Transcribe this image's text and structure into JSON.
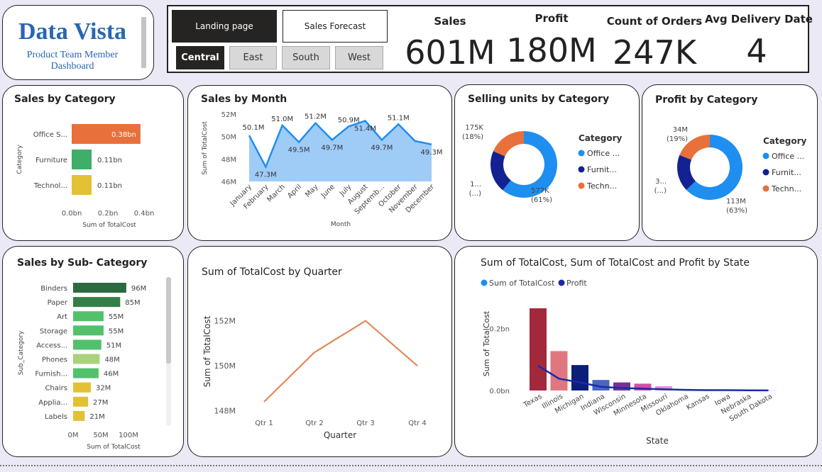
{
  "logo": {
    "brand": "Data Vista",
    "sub1": "Product Team Member",
    "sub2": "Dashboard"
  },
  "nav": {
    "landing": "Landing page",
    "forecast": "Sales Forecast"
  },
  "regions": [
    "Central",
    "East",
    "South",
    "West"
  ],
  "kpis": [
    {
      "label": "Sales",
      "value": "601M"
    },
    {
      "label": "Profit",
      "value": "180M"
    },
    {
      "label": "Count of Orders",
      "value": "247K"
    },
    {
      "label": "Avg Delivery Date",
      "value": "4"
    }
  ],
  "colors": {
    "orange": "#e8703a",
    "green": "#3fae6a",
    "yellow": "#e3c134",
    "blue": "#1e8ef0",
    "navy": "#142190",
    "area": "#9fcbf7",
    "line": "#1e8ef0",
    "quarter": "#e08a5c"
  },
  "chart_data": [
    {
      "id": "sales-by-category",
      "type": "bar",
      "orientation": "horizontal",
      "title": "Sales by Category",
      "xlabel": "Sum of TotalCost",
      "ylabel": "Category",
      "categories": [
        "Office S...",
        "Furniture",
        "Technol..."
      ],
      "values": [
        0.38,
        0.11,
        0.11
      ],
      "data_labels": [
        "0.38bn",
        "0.11bn",
        "0.11bn"
      ],
      "xticks": [
        "0.0bn",
        "0.2bn",
        "0.4bn"
      ],
      "xlim": [
        0,
        0.4
      ]
    },
    {
      "id": "sales-by-month",
      "type": "area",
      "title": "Sales by Month",
      "xlabel": "Month",
      "ylabel": "Sum of TotalCost",
      "x": [
        "January",
        "February",
        "March",
        "April",
        "May",
        "June",
        "July",
        "August",
        "Septemb...",
        "October",
        "November",
        "December"
      ],
      "values": [
        50.1,
        47.3,
        51.0,
        49.5,
        51.2,
        49.7,
        50.9,
        51.4,
        49.7,
        51.1,
        49.6,
        49.3
      ],
      "data_labels": [
        "50.1M",
        "47.3M",
        "51.0M",
        "49.5M",
        "51.2M",
        "49.7M",
        "50.9M",
        "51.4M",
        "49.7M",
        "51.1M",
        "",
        "49.3M"
      ],
      "yticks": [
        "46M",
        "48M",
        "50M",
        "52M"
      ],
      "ylim": [
        46,
        52
      ]
    },
    {
      "id": "selling-units-by-category",
      "type": "pie",
      "donut": true,
      "title": "Selling units by Category",
      "legend_title": "Category",
      "labels": [
        "Office ...",
        "Furnit...",
        "Techn..."
      ],
      "values": [
        577,
        195,
        175
      ],
      "data_labels": [
        "577K",
        "1...",
        "175K"
      ],
      "percent_labels": [
        "(61%)",
        "(...)",
        "(18%)"
      ]
    },
    {
      "id": "profit-by-category",
      "type": "pie",
      "donut": true,
      "title": "Profit by Category",
      "legend_title": "Category",
      "labels": [
        "Office ...",
        "Furnit...",
        "Techn..."
      ],
      "values": [
        113,
        33,
        34
      ],
      "data_labels": [
        "113M",
        "3...",
        "34M"
      ],
      "percent_labels": [
        "(63%)",
        "(...)",
        "(19%)"
      ]
    },
    {
      "id": "sales-by-sub-category",
      "type": "bar",
      "orientation": "horizontal",
      "title": "Sales by Sub- Category",
      "xlabel": "Sum of TotalCost",
      "ylabel": "Sub_Category",
      "categories": [
        "Binders",
        "Paper",
        "Art",
        "Storage",
        "Access...",
        "Phones",
        "Furnish...",
        "Chairs",
        "Applia...",
        "Labels"
      ],
      "values": [
        96,
        85,
        55,
        55,
        51,
        48,
        46,
        32,
        27,
        21
      ],
      "data_labels": [
        "96M",
        "85M",
        "55M",
        "55M",
        "51M",
        "48M",
        "46M",
        "32M",
        "27M",
        "21M"
      ],
      "xticks": [
        "0M",
        "50M",
        "100M"
      ],
      "xlim": [
        0,
        100
      ]
    },
    {
      "id": "totalcost-by-quarter",
      "type": "line",
      "title": "Sum of TotalCost by Quarter",
      "xlabel": "Quarter",
      "ylabel": "Sum of TotalCost",
      "x": [
        "Qtr 1",
        "Qtr 2",
        "Qtr 3",
        "Qtr 4"
      ],
      "values": [
        148.4,
        150.6,
        152.0,
        150.0
      ],
      "yticks": [
        "148M",
        "150M",
        "152M"
      ],
      "ylim": [
        147.8,
        152.4
      ]
    },
    {
      "id": "by-state",
      "type": "bar",
      "title": "Sum of TotalCost, Sum of TotalCost and Profit by State",
      "xlabel": "State",
      "ylabel": "Sum of TotalCost",
      "legend": [
        "Sum of TotalCost",
        "Profit"
      ],
      "categories": [
        "Texas",
        "Illinois",
        "Michigan",
        "Indiana",
        "Wisconsin",
        "Minnesota",
        "Missouri",
        "Oklahoma",
        "Kansas",
        "Iowa",
        "Nebraska",
        "South Dakota"
      ],
      "series": [
        {
          "name": "Sum of TotalCost",
          "values": [
            0.265,
            0.127,
            0.082,
            0.034,
            0.026,
            0.022,
            0.014,
            0.005,
            0.004,
            0.003,
            0.002,
            0.001
          ]
        },
        {
          "name": "Profit",
          "values": [
            0.08,
            0.038,
            0.026,
            0.012,
            0.008,
            0.006,
            0.004,
            0.002,
            0.001,
            0.001,
            0.0005,
            0.0003
          ]
        }
      ],
      "yticks": [
        "0.0bn",
        "0.2bn"
      ],
      "ylim": [
        0,
        0.265
      ]
    }
  ]
}
